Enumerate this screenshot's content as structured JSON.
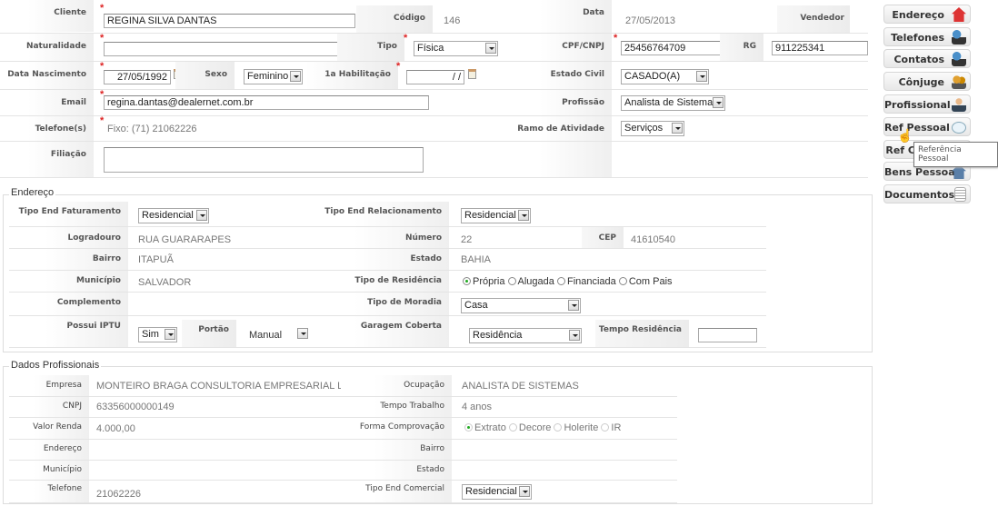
{
  "cliente": {
    "cliente_label": "Cliente",
    "cliente_value": "REGINA SILVA DANTAS",
    "codigo_label": "Código",
    "codigo_value": "146",
    "data_label": "Data",
    "data_value": "27/05/2013",
    "vendedor_label": "Vendedor",
    "naturalidade_label": "Naturalidade",
    "naturalidade_value": "",
    "tipo_label": "Tipo",
    "tipo_value": "Física",
    "cpf_label": "CPF/CNPJ",
    "cpf_value": "25456764709",
    "rg_label": "RG",
    "rg_value": "911225341",
    "nascimento_label": "Data Nascimento",
    "nascimento_value": "27/05/1992",
    "sexo_label": "Sexo",
    "sexo_value": "Feminino",
    "habilitacao_label": "1a Habilitação",
    "habilitacao_value": "/ /",
    "estado_civil_label": "Estado Civil",
    "estado_civil_value": "CASADO(A)",
    "email_label": "Email",
    "email_value": "regina.dantas@dealernet.com.br",
    "profissao_label": "Profissão",
    "profissao_value": "Analista de Sistema",
    "telefones_label": "Telefone(s)",
    "telefones_value": "Fixo: (71) 21062226",
    "ramo_label": "Ramo de Atividade",
    "ramo_value": "Serviços",
    "filiacao_label": "Filiação",
    "filiacao_value": ""
  },
  "side_buttons": [
    {
      "label": "Endereço",
      "icon": "house-icon",
      "color": "#d33"
    },
    {
      "label": "Telefones",
      "icon": "telephone-icon",
      "color": "#4a8fc9"
    },
    {
      "label": "Contatos",
      "icon": "contacts-icon",
      "color": "#4a8fc9"
    },
    {
      "label": "Cônjuge",
      "icon": "couple-icon",
      "color": "#e0a030"
    },
    {
      "label": "Profissional",
      "icon": "businessman-icon",
      "color": "#345"
    },
    {
      "label": "Ref Pessoal",
      "icon": "chat-bubbles-icon",
      "color": "#6ac"
    },
    {
      "label": "Ref C",
      "icon": "reference-icon",
      "color": "#8c8"
    },
    {
      "label": "Bens Pessoais",
      "icon": "house-blue-icon",
      "color": "#5a7fa8"
    },
    {
      "label": "Documentos",
      "icon": "document-icon",
      "color": "#ccc"
    }
  ],
  "tooltip": "Referência Pessoal",
  "endereco": {
    "legend": "Endereço",
    "tipo_fat_label": "Tipo End Faturamento",
    "tipo_fat_value": "Residencial",
    "tipo_rel_label": "Tipo End Relacionamento",
    "tipo_rel_value": "Residencial",
    "logradouro_label": "Logradouro",
    "logradouro_value": "RUA GUARARAPES",
    "numero_label": "Número",
    "numero_value": "22",
    "cep_label": "CEP",
    "cep_value": "41610540",
    "bairro_label": "Bairro",
    "bairro_value": "ITAPUÃ",
    "estado_label": "Estado",
    "estado_value": "BAHIA",
    "municipio_label": "Município",
    "municipio_value": "SALVADOR",
    "tipo_res_label": "Tipo de Residência",
    "tipo_res_options": [
      "Própria",
      "Alugada",
      "Financiada",
      "Com Pais"
    ],
    "tipo_res_selected": "Própria",
    "complemento_label": "Complemento",
    "moradia_label": "Tipo de Moradia",
    "moradia_value": "Casa",
    "iptu_label": "Possui IPTU",
    "iptu_value": "Sim",
    "portao_label": "Portão",
    "portao_value": "Manual",
    "garagem_label": "Garagem Coberta",
    "garagem_value": "Residência",
    "tempo_res_label": "Tempo Residência",
    "tempo_res_value": ""
  },
  "profissionais": {
    "legend": "Dados Profissionais",
    "empresa_label": "Empresa",
    "empresa_value": "MONTEIRO BRAGA CONSULTORIA EMPRESARIAL LTDA.",
    "ocupacao_label": "Ocupação",
    "ocupacao_value": "ANALISTA DE SISTEMAS",
    "cnpj_label": "CNPJ",
    "cnpj_value": "63356000000149",
    "tempo_label": "Tempo Trabalho",
    "tempo_value": "4 anos",
    "renda_label": "Valor Renda",
    "renda_value": "4.000,00",
    "comprovacao_label": "Forma Comprovação",
    "comprovacao_options": [
      "Extrato",
      "Decore",
      "Holerite",
      "IR"
    ],
    "comprovacao_selected": "Extrato",
    "endereco_label": "Endereço",
    "bairro_label": "Bairro",
    "municipio_label": "Município",
    "estado_label": "Estado",
    "telefone_label": "Telefone",
    "telefone_value": "21062226",
    "tipo_com_label": "Tipo End Comercial",
    "tipo_com_value": "Residencial"
  }
}
